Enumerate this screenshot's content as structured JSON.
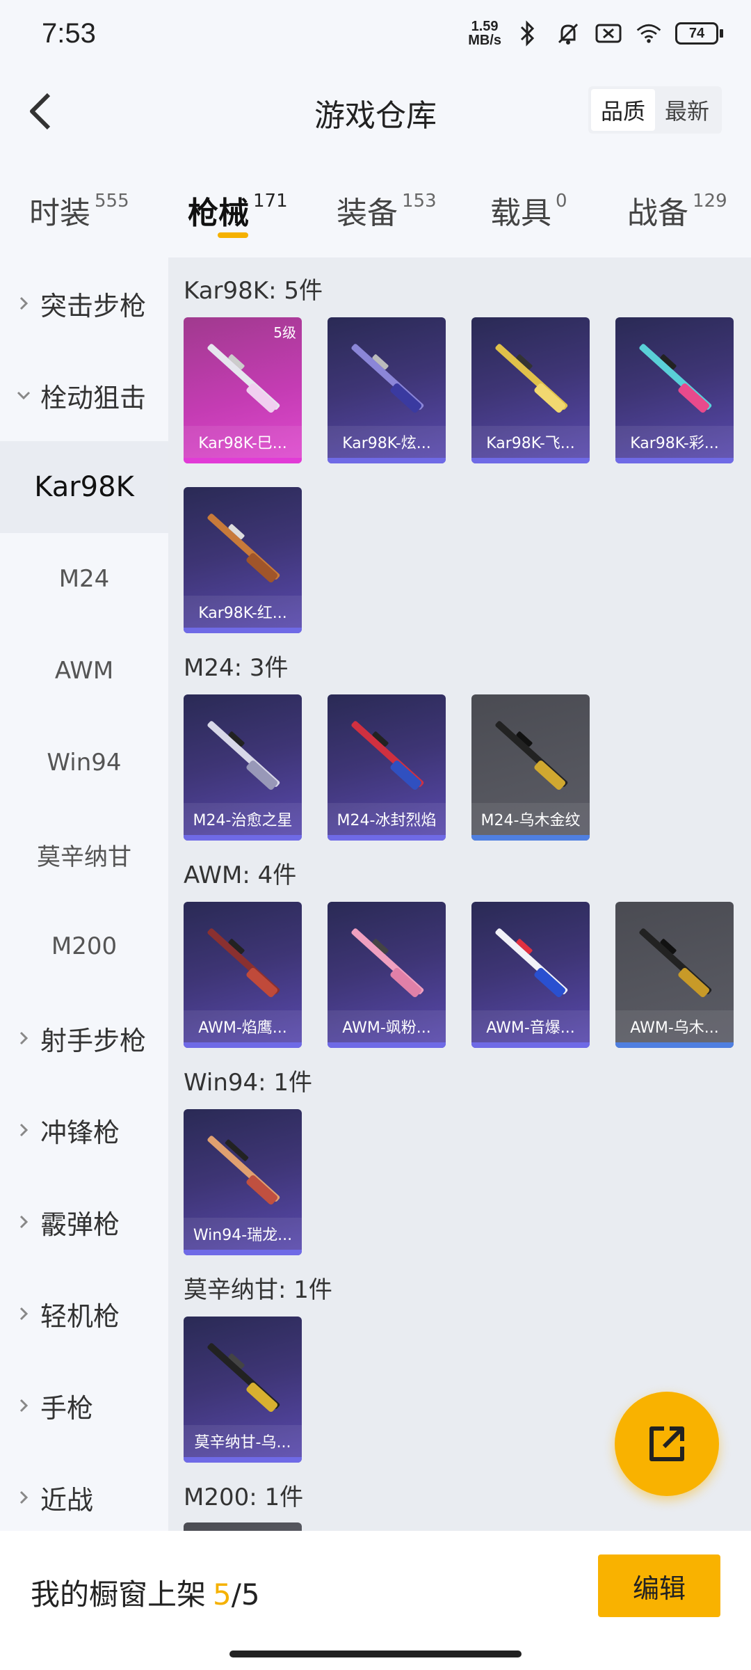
{
  "status_bar": {
    "time": "7:53",
    "net_speed_value": "1.59",
    "net_speed_unit": "MB/s",
    "battery": "74"
  },
  "header": {
    "title": "游戏仓库",
    "sort_options": [
      "品质",
      "最新"
    ],
    "sort_selected": "品质"
  },
  "tabs": [
    {
      "label": "时装",
      "count": "555"
    },
    {
      "label": "枪械",
      "count": "171"
    },
    {
      "label": "装备",
      "count": "153"
    },
    {
      "label": "载具",
      "count": "0"
    },
    {
      "label": "战备",
      "count": "129"
    }
  ],
  "active_tab": "枪械",
  "sidebar": {
    "items": [
      {
        "label": "突击步枪",
        "type": "category",
        "expanded": false
      },
      {
        "label": "栓动狙击",
        "type": "category",
        "expanded": true
      },
      {
        "label": "Kar98K",
        "type": "sub",
        "active": true
      },
      {
        "label": "M24",
        "type": "sub"
      },
      {
        "label": "AWM",
        "type": "sub"
      },
      {
        "label": "Win94",
        "type": "sub"
      },
      {
        "label": "莫辛纳甘",
        "type": "sub"
      },
      {
        "label": "M200",
        "type": "sub"
      },
      {
        "label": "射手步枪",
        "type": "category",
        "expanded": false
      },
      {
        "label": "冲锋枪",
        "type": "category",
        "expanded": false
      },
      {
        "label": "霰弹枪",
        "type": "category",
        "expanded": false
      },
      {
        "label": "轻机枪",
        "type": "category",
        "expanded": false
      },
      {
        "label": "手枪",
        "type": "category",
        "expanded": false
      },
      {
        "label": "近战",
        "type": "category",
        "expanded": false
      }
    ]
  },
  "groups": [
    {
      "title": "Kar98K: 5件",
      "items": [
        {
          "name": "Kar98K-巳...",
          "level": "5级",
          "style": "pink"
        },
        {
          "name": "Kar98K-炫...",
          "style": "purple"
        },
        {
          "name": "Kar98K-飞...",
          "style": "purple"
        },
        {
          "name": "Kar98K-彩...",
          "style": "purple"
        },
        {
          "name": "Kar98K-红...",
          "style": "purple"
        }
      ]
    },
    {
      "title": "M24: 3件",
      "items": [
        {
          "name": "M24-治愈之星",
          "style": "purple"
        },
        {
          "name": "M24-冰封烈焰",
          "style": "purple"
        },
        {
          "name": "M24-乌木金纹",
          "style": "gray"
        }
      ]
    },
    {
      "title": "AWM: 4件",
      "items": [
        {
          "name": "AWM-焰鹰...",
          "style": "purple"
        },
        {
          "name": "AWM-飒粉...",
          "style": "purple"
        },
        {
          "name": "AWM-音爆...",
          "style": "purple"
        },
        {
          "name": "AWM-乌木...",
          "style": "gray"
        }
      ]
    },
    {
      "title": "Win94: 1件",
      "items": [
        {
          "name": "Win94-瑞龙...",
          "style": "purple"
        }
      ]
    },
    {
      "title": "莫辛纳甘: 1件",
      "items": [
        {
          "name": "莫辛纳甘-乌...",
          "style": "purple"
        }
      ]
    },
    {
      "title": "M200: 1件",
      "items": []
    }
  ],
  "bottom": {
    "showcase_label": "我的橱窗上架",
    "showcase_count": "5",
    "showcase_total": "/5",
    "edit_label": "编辑"
  },
  "colors": {
    "accent": "#f9b200",
    "card_purple": "#3e3575",
    "card_pink": "#c43cb3",
    "card_gray": "#55565e"
  }
}
